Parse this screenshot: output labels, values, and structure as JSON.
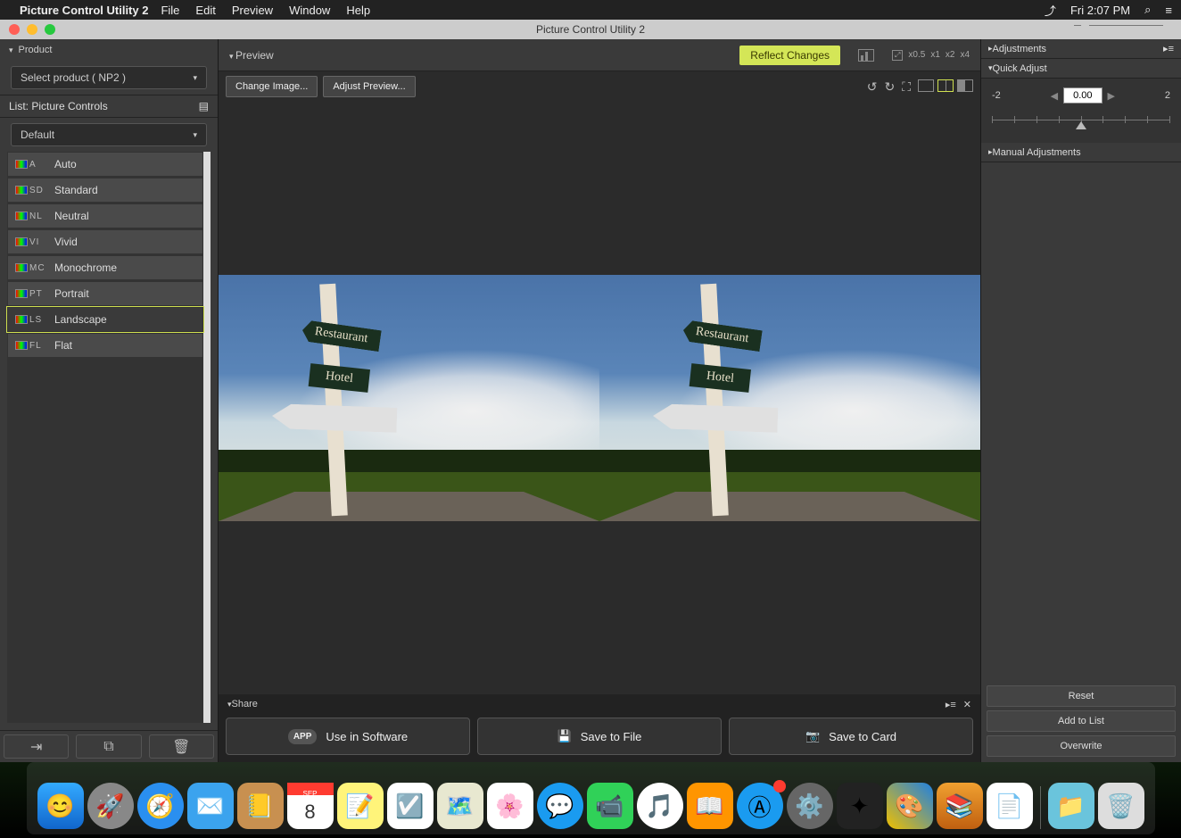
{
  "menubar": {
    "app": "Picture Control Utility 2",
    "items": [
      "File",
      "Edit",
      "Preview",
      "Window",
      "Help"
    ],
    "clock": "Fri 2:07 PM"
  },
  "window": {
    "title": "Picture Control Utility 2"
  },
  "sidebar": {
    "product_label": "Product",
    "product_select": "Select product ( NP2 )",
    "list_header": "List: Picture Controls",
    "group_select": "Default",
    "items": [
      {
        "code": "A",
        "label": "Auto"
      },
      {
        "code": "SD",
        "label": "Standard"
      },
      {
        "code": "NL",
        "label": "Neutral"
      },
      {
        "code": "VI",
        "label": "Vivid"
      },
      {
        "code": "MC",
        "label": "Monochrome"
      },
      {
        "code": "PT",
        "label": "Portrait"
      },
      {
        "code": "LS",
        "label": "Landscape"
      },
      {
        "code": "FL",
        "label": "Flat"
      }
    ],
    "selected_index": 6
  },
  "toolbar": {
    "preview_label": "Preview",
    "change_image": "Change Image...",
    "adjust_preview": "Adjust Preview...",
    "reflect": "Reflect Changes",
    "zoom_levels": [
      "x0.5",
      "x1",
      "x2",
      "x4"
    ]
  },
  "scene": {
    "sign1": "Restaurant",
    "sign2": "Hotel"
  },
  "share": {
    "header": "Share",
    "use_in_software": "Use in Software",
    "save_to_file": "Save to File",
    "save_to_card": "Save to Card"
  },
  "right": {
    "adjustments": "Adjustments",
    "quick_adjust": "Quick Adjust",
    "min": "-2",
    "max": "2",
    "value": "0.00",
    "manual": "Manual Adjustments",
    "reset": "Reset",
    "add_to_list": "Add to List",
    "overwrite": "Overwrite"
  },
  "dock": {
    "cal_day": "8",
    "cal_top": "SEP"
  }
}
